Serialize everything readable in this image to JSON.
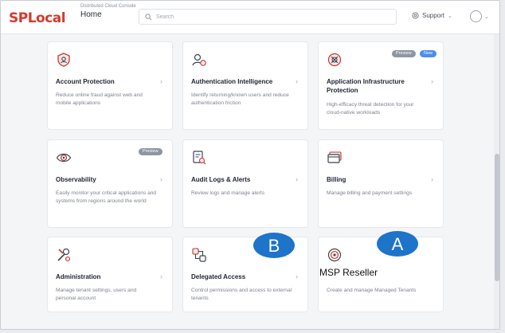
{
  "header": {
    "logo": "SPLocal",
    "console_subtitle": "Distributed Cloud Console",
    "console_title": "Home",
    "search_placeholder": "Search",
    "support_label": "Support"
  },
  "cards": [
    {
      "title": "Account Protection",
      "desc": "Reduce online fraud against web and mobile applications",
      "icon": "account-protection-icon"
    },
    {
      "title": "Authentication Intelligence",
      "desc": "Identify returning/known users and reduce authentication friction",
      "icon": "authentication-intelligence-icon"
    },
    {
      "title": "Application Infrastructure Protection",
      "desc": "High-efficacy threat detection for your cloud-native workloads",
      "icon": "application-infrastructure-icon",
      "badges": [
        "Preview",
        "New"
      ]
    },
    {
      "title": "Observability",
      "desc": "Easily monitor your critical applications and systems from regions around the world",
      "icon": "observability-icon",
      "badges": [
        "Preview"
      ]
    },
    {
      "title": "Audit Logs & Alerts",
      "desc": "Review logs and manage alerts",
      "icon": "audit-logs-icon"
    },
    {
      "title": "Billing",
      "desc": "Manage billing and payment settings",
      "icon": "billing-icon"
    },
    {
      "title": "Administration",
      "desc": "Manage tenant settings, users and personal account",
      "icon": "administration-icon"
    },
    {
      "title": "Delegated Access",
      "desc": "Control permissions and access to external tenants",
      "icon": "delegated-access-icon"
    },
    {
      "title": "MSP Reseller",
      "desc": "Create and manage Managed Tenants",
      "icon": "msp-reseller-icon"
    }
  ],
  "callouts": {
    "a": "A",
    "b": "B"
  },
  "overlay_label": "MSP Reseller",
  "colors": {
    "logo": "#d33a2c",
    "callout": "#1d74c9",
    "new_badge": "#4b8ef0",
    "preview_badge": "#8f96a3"
  }
}
